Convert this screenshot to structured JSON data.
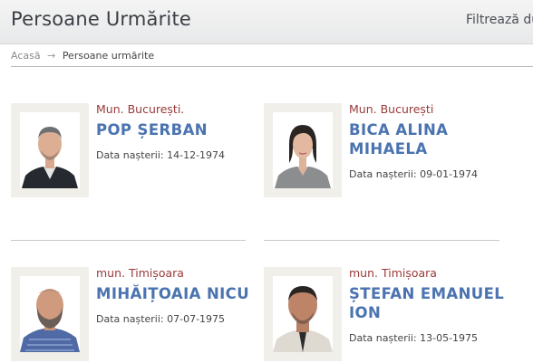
{
  "header": {
    "title": "Persoane Urmărite",
    "filter_label": "Filtrează du"
  },
  "breadcrumb": {
    "home": "Acasă",
    "separator": "→",
    "current": "Persoane urmărite"
  },
  "persons": [
    {
      "city": "Mun. București.",
      "name": "POP ȘERBAN",
      "dob": "Data nașterii: 14-12-1974"
    },
    {
      "city": "Mun. București",
      "name": "BICA ALINA MIHAELA",
      "dob": "Data nașterii: 09-01-1974"
    },
    {
      "city": "mun. Timișoara",
      "name": "MIHĂIȚOAIA NICU",
      "dob": "Data nașterii: 07-07-1975"
    },
    {
      "city": "mun. Timișoara",
      "name": "ȘTEFAN EMANUEL ION",
      "dob": "Data nașterii: 13-05-1975"
    }
  ],
  "colors": {
    "city": "#9a3a3a",
    "name": "#4a73b0"
  }
}
